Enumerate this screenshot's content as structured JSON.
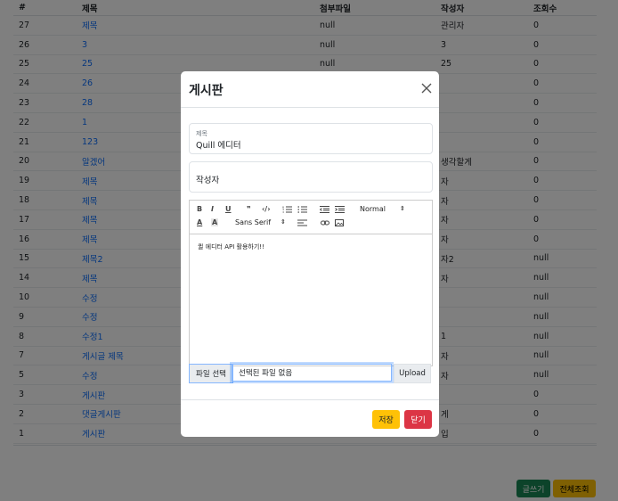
{
  "table": {
    "headers": [
      "#",
      "제목",
      "첨부파일",
      "작성자",
      "조회수"
    ],
    "rows": [
      {
        "num": "27",
        "title": "제목",
        "file": "null",
        "writer": "관리자",
        "views": "0"
      },
      {
        "num": "26",
        "title": "3",
        "file": "null",
        "writer": "3",
        "views": "0"
      },
      {
        "num": "25",
        "title": "25",
        "file": "null",
        "writer": "25",
        "views": "0"
      },
      {
        "num": "24",
        "title": "26",
        "file": "",
        "writer": "",
        "views": "0"
      },
      {
        "num": "23",
        "title": "28",
        "file": "",
        "writer": "",
        "views": "0"
      },
      {
        "num": "22",
        "title": "1",
        "file": "",
        "writer": "",
        "views": "0"
      },
      {
        "num": "21",
        "title": "123",
        "file": "",
        "writer": "",
        "views": "0"
      },
      {
        "num": "20",
        "title": "알겠어",
        "file": "",
        "writer": "생각할게",
        "views": "0"
      },
      {
        "num": "19",
        "title": "제목",
        "file": "",
        "writer": "자",
        "views": "0"
      },
      {
        "num": "18",
        "title": "제목",
        "file": "",
        "writer": "자",
        "views": "0"
      },
      {
        "num": "17",
        "title": "제목",
        "file": "",
        "writer": "자",
        "views": "0"
      },
      {
        "num": "16",
        "title": "제목",
        "file": "",
        "writer": "자",
        "views": "0"
      },
      {
        "num": "15",
        "title": "제목2",
        "file": "",
        "writer": "자2",
        "views": "null"
      },
      {
        "num": "14",
        "title": "제목",
        "file": "",
        "writer": "자",
        "views": "null"
      },
      {
        "num": "10",
        "title": "수정",
        "file": "",
        "writer": "",
        "views": "null"
      },
      {
        "num": "9",
        "title": "수정",
        "file": "",
        "writer": "",
        "views": "null"
      },
      {
        "num": "8",
        "title": "수정1",
        "file": "",
        "writer": "1",
        "views": "null"
      },
      {
        "num": "7",
        "title": "게시글 제목",
        "file": "",
        "writer": "자",
        "views": "null"
      },
      {
        "num": "5",
        "title": "수정",
        "file": "",
        "writer": "자",
        "views": "null"
      },
      {
        "num": "3",
        "title": "게시판",
        "file": "",
        "writer": "",
        "views": "0"
      },
      {
        "num": "2",
        "title": "댓글게시판",
        "file": "",
        "writer": "게",
        "views": "0"
      },
      {
        "num": "1",
        "title": "게시판",
        "file": "",
        "writer": "입",
        "views": "0"
      }
    ]
  },
  "buttons": {
    "write": "글쓰기",
    "all": "전체조회"
  },
  "colors": {
    "link": "#0d6efd",
    "write_btn": "#198754",
    "all_btn": "#ffc107",
    "save_btn": "#ffc107",
    "close_btn": "#dc3545"
  },
  "modal": {
    "title": "게시판",
    "close_icon": "close-icon",
    "title_field": {
      "label": "제목",
      "value": "Quill 에디터"
    },
    "writer_field": {
      "placeholder": "작성자"
    },
    "editor": {
      "toolbar": {
        "header_select": "Normal",
        "font_select": "Sans Serif"
      },
      "content": "퀼 에디터 API 활용하기!!"
    },
    "file": {
      "choose_label": "파일 선택",
      "no_file": "선택된 파일 없음",
      "upload_label": "Upload"
    },
    "footer": {
      "save": "저장",
      "close": "닫기"
    }
  }
}
